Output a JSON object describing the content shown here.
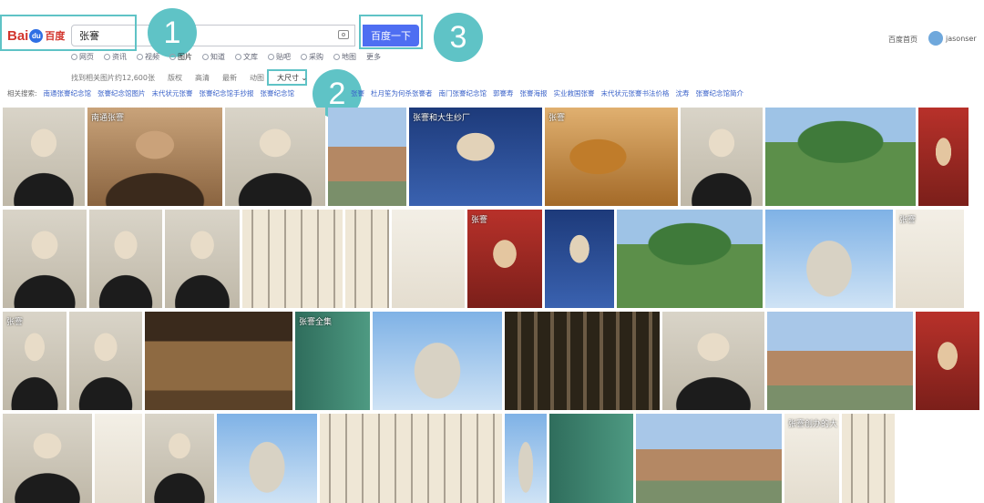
{
  "header": {
    "logo_text": "Bai",
    "logo_paw": "du",
    "logo_cn": "百度",
    "search_value": "张謇",
    "search_button": "百度一下",
    "home_link": "百度首页",
    "username": "jasonser"
  },
  "annotations": [
    "1",
    "2",
    "3"
  ],
  "nav": {
    "tabs": [
      {
        "label": "网页",
        "icon": "search-icon"
      },
      {
        "label": "资讯",
        "icon": "news-icon"
      },
      {
        "label": "视频",
        "icon": "video-icon"
      },
      {
        "label": "图片",
        "icon": "image-icon"
      },
      {
        "label": "知道",
        "icon": "question-icon"
      },
      {
        "label": "文库",
        "icon": "doc-icon"
      },
      {
        "label": "贴吧",
        "icon": "forum-icon"
      },
      {
        "label": "采购",
        "icon": "cart-icon"
      },
      {
        "label": "地图",
        "icon": "map-icon"
      },
      {
        "label": "更多",
        "icon": ""
      }
    ],
    "active_index": 3
  },
  "filters": {
    "result_count": "找到相关图片约12,600张",
    "items": [
      "版权",
      "高清",
      "最新",
      "动图"
    ],
    "size_dropdown": "大尺寸"
  },
  "related": {
    "label": "相关搜索:",
    "items": [
      "南通张謇纪念馆",
      "张謇纪念馆图片",
      "末代状元张謇",
      "张謇纪念馆手抄报",
      "张謇纪念馆",
      "张謇",
      "杜月笙为何杀张謇者",
      "南门张謇纪念馆",
      "郭謇寿",
      "张謇海报",
      "实业救国张謇",
      "末代状元张謇书法价格",
      "沈寿",
      "张謇纪念馆简介"
    ]
  },
  "grid": {
    "row1": [
      {
        "style": "portrait"
      },
      {
        "style": "sepia",
        "caption": "南通张謇"
      },
      {
        "style": "portrait"
      },
      {
        "style": "building"
      },
      {
        "style": "navy",
        "caption": "张謇和大生纱厂"
      },
      {
        "style": "map",
        "caption": "张謇"
      },
      {
        "style": "portrait"
      },
      {
        "style": "green"
      },
      {
        "style": "red"
      }
    ],
    "row2": [
      {
        "style": "portrait"
      },
      {
        "style": "portrait"
      },
      {
        "style": "portrait"
      },
      {
        "style": "calli"
      },
      {
        "style": "calli"
      },
      {
        "style": "light"
      },
      {
        "style": "red",
        "caption": "张謇"
      },
      {
        "style": "navy"
      },
      {
        "style": "green"
      },
      {
        "style": "statue"
      },
      {
        "style": "light",
        "caption": "张謇"
      }
    ],
    "row3": [
      {
        "style": "portrait",
        "caption": "张謇"
      },
      {
        "style": "portrait"
      },
      {
        "style": "room"
      },
      {
        "style": "book",
        "caption": "张謇全集"
      },
      {
        "style": "statue"
      },
      {
        "style": "group"
      },
      {
        "style": "portrait"
      },
      {
        "style": "building"
      },
      {
        "style": "red"
      }
    ],
    "row4": [
      {
        "style": "portrait"
      },
      {
        "style": "light"
      },
      {
        "style": "portrait"
      },
      {
        "style": "statue"
      },
      {
        "style": "calli"
      },
      {
        "style": "statue"
      },
      {
        "style": "book"
      },
      {
        "style": "building"
      },
      {
        "style": "light",
        "caption": "张謇创办的大"
      },
      {
        "style": "calli"
      }
    ]
  }
}
